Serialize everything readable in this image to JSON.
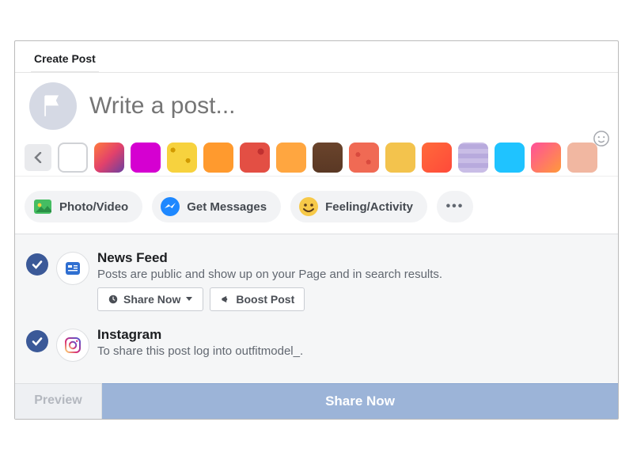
{
  "tab": {
    "label": "Create Post"
  },
  "composer": {
    "placeholder": "Write a post..."
  },
  "backgrounds": [
    {
      "name": "blank",
      "css": "background:#fff"
    },
    {
      "name": "orange-pattern",
      "css": "background:linear-gradient(135deg,#ff7a3d,#e2416b 50%,#6b3fa0)"
    },
    {
      "name": "magenta",
      "css": "background:#d500d1"
    },
    {
      "name": "yellow-dots",
      "css": "background:radial-gradient(circle at 20% 25%, #d19a00 0 3px, transparent 3px), radial-gradient(circle at 70% 60%, #d19a00 0 3px, transparent 3px), #f7d23e"
    },
    {
      "name": "orange",
      "css": "background:#ff9a2e"
    },
    {
      "name": "red",
      "css": "background:radial-gradient(circle at 70% 30%, #c03030 0 4px, transparent 4px),#e34f44"
    },
    {
      "name": "amber",
      "css": "background:#ffa640"
    },
    {
      "name": "brown",
      "css": "background:linear-gradient(180deg,#6a442c,#5a3824)"
    },
    {
      "name": "coral",
      "css": "background:radial-gradient(circle at 30% 40%, #d94a3e 0 3px, transparent 3px), radial-gradient(circle at 65% 65%, #d94a3e 0 3px, transparent 3px),#f06a54"
    },
    {
      "name": "mustard",
      "css": "background:#f3c34d"
    },
    {
      "name": "vermillion",
      "css": "background:linear-gradient(135deg,#ff6a3a,#ff4a3a)"
    },
    {
      "name": "lavender",
      "css": "background:repeating-linear-gradient(0deg,#c9bde6 0 6px,#b8aadd 6px 12px)"
    },
    {
      "name": "cyan",
      "css": "background:#1fc3ff"
    },
    {
      "name": "pink-orange",
      "css": "background:linear-gradient(135deg,#ff4f9a,#ff9a3a)"
    },
    {
      "name": "peach",
      "css": "background:#f1b7a1"
    }
  ],
  "pills": {
    "photo": "Photo/Video",
    "messages": "Get Messages",
    "feeling": "Feeling/Activity"
  },
  "channels": {
    "newsfeed": {
      "title": "News Feed",
      "desc": "Posts are public and show up on your Page and in search results.",
      "share_now": "Share Now",
      "boost": "Boost Post"
    },
    "instagram": {
      "title": "Instagram",
      "desc": "To share this post log into outfitmodel_."
    }
  },
  "footer": {
    "preview": "Preview",
    "share": "Share Now"
  }
}
